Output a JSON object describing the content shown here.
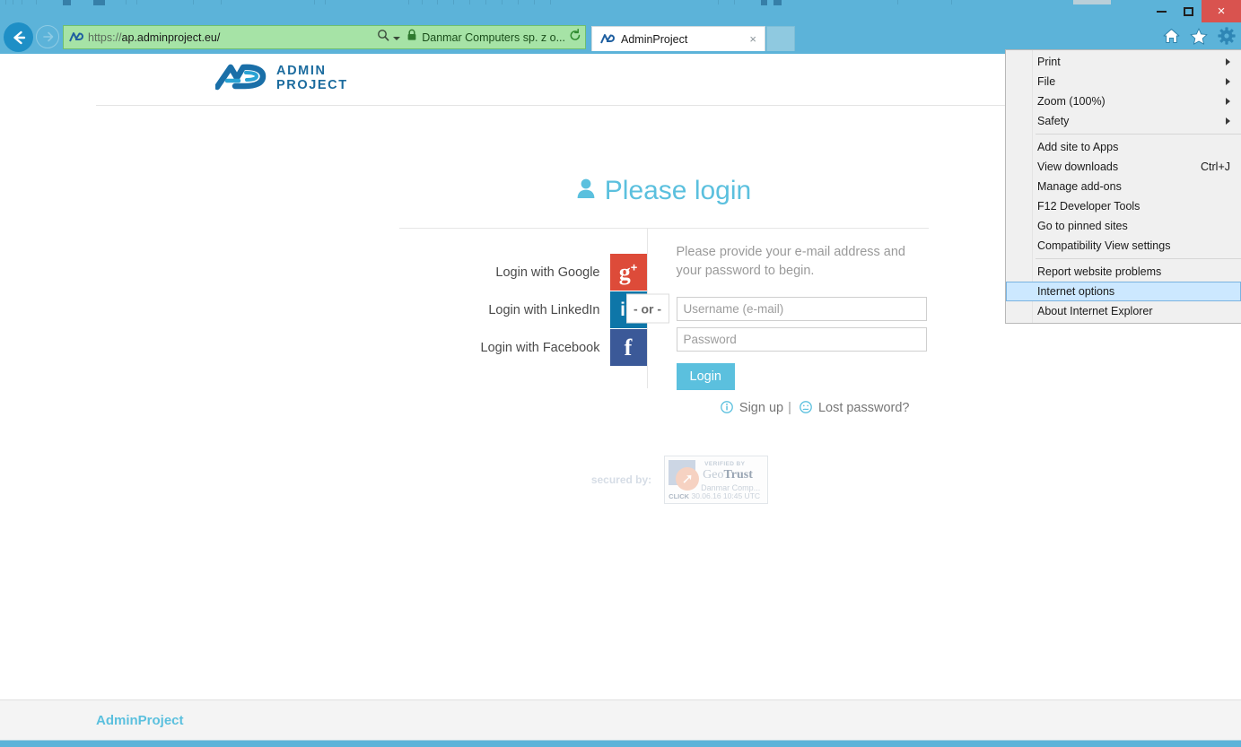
{
  "browser": {
    "window_controls": {
      "minimize": "Minimize",
      "maximize": "Maximize",
      "close": "×"
    },
    "back_label": "Back",
    "forward_label": "Forward",
    "address": {
      "url_scheme": "https://",
      "url_rest": "ap.adminproject.eu/",
      "url_full": "https://ap.adminproject.eu/",
      "organization": "Danmar Computers sp. z o...",
      "search_icon": "search-icon",
      "lock_icon": "lock-icon",
      "refresh_icon": "refresh-icon",
      "favicon": "adminproject-favicon"
    },
    "tab": {
      "title": "AdminProject",
      "close_label": "×",
      "new_tab_label": ""
    },
    "toolbar_icons": [
      {
        "name": "home-icon",
        "label": "Home"
      },
      {
        "name": "favorites-star-icon",
        "label": "Favorites"
      },
      {
        "name": "tools-gear-icon",
        "label": "Tools"
      }
    ]
  },
  "ie_menu": {
    "groups": [
      {
        "items": [
          {
            "label": "Print",
            "accel": "",
            "submenu": true,
            "selected": false
          },
          {
            "label": "File",
            "accel": "",
            "submenu": true,
            "selected": false
          },
          {
            "label": "Zoom (100%)",
            "accel": "",
            "submenu": true,
            "selected": false
          },
          {
            "label": "Safety",
            "accel": "",
            "submenu": true,
            "selected": false
          }
        ]
      },
      {
        "items": [
          {
            "label": "Add site to Apps",
            "accel": "",
            "submenu": false,
            "selected": false
          },
          {
            "label": "View downloads",
            "accel": "Ctrl+J",
            "submenu": false,
            "selected": false
          },
          {
            "label": "Manage add-ons",
            "accel": "",
            "submenu": false,
            "selected": false
          },
          {
            "label": "F12 Developer Tools",
            "accel": "",
            "submenu": false,
            "selected": false
          },
          {
            "label": "Go to pinned sites",
            "accel": "",
            "submenu": false,
            "selected": false
          },
          {
            "label": "Compatibility View settings",
            "accel": "",
            "submenu": false,
            "selected": false
          }
        ]
      },
      {
        "items": [
          {
            "label": "Report website problems",
            "accel": "",
            "submenu": false,
            "selected": false
          },
          {
            "label": "Internet options",
            "accel": "",
            "submenu": false,
            "selected": true
          },
          {
            "label": "About Internet Explorer",
            "accel": "",
            "submenu": false,
            "selected": false
          }
        ]
      }
    ]
  },
  "page": {
    "logo": {
      "line1": "ADMIN",
      "line2": "PROJECT",
      "mark": "ap-logo-mark"
    },
    "login": {
      "title": "Please login",
      "title_icon": "user-icon",
      "intro": "Please provide your e-mail address and your password to begin.",
      "or_badge": "- or -",
      "social": [
        {
          "label": "Login with Google",
          "icon": "google-plus-icon",
          "glyph": "g",
          "sup": "+",
          "color": "#dd4b39"
        },
        {
          "label": "Login with LinkedIn",
          "icon": "linkedin-icon",
          "glyph": "in",
          "sup": "",
          "color": "#0e76a8"
        },
        {
          "label": "Login with Facebook",
          "icon": "facebook-icon",
          "glyph": "f",
          "sup": "",
          "color": "#3b5998"
        }
      ],
      "username_placeholder": "Username (e-mail)",
      "username_value": "",
      "password_placeholder": "Password",
      "password_value": "",
      "login_button": "Login",
      "signup_link": "Sign up",
      "signup_icon": "info-circle-icon",
      "separator": "|",
      "lost_password_link": "Lost password?",
      "lost_password_icon": "confused-face-icon"
    },
    "secured": {
      "label": "secured by:",
      "badge": {
        "verified_by": "VERIFIED BY",
        "brand_light": "Geo",
        "brand_bold": "Trust",
        "brand_tm": "®",
        "organization": "Danmar Comp...",
        "click_label": "CLICK",
        "timestamp": "30.06.16 10:45 UTC"
      }
    },
    "footer": {
      "brand": "AdminProject"
    }
  },
  "colors": {
    "chrome_blue": "#5cb3d9",
    "accent_blue": "#5bc0de",
    "ev_green": "#a6e3a6",
    "close_red": "#d9534f",
    "menu_highlight": "#cce8ff"
  }
}
